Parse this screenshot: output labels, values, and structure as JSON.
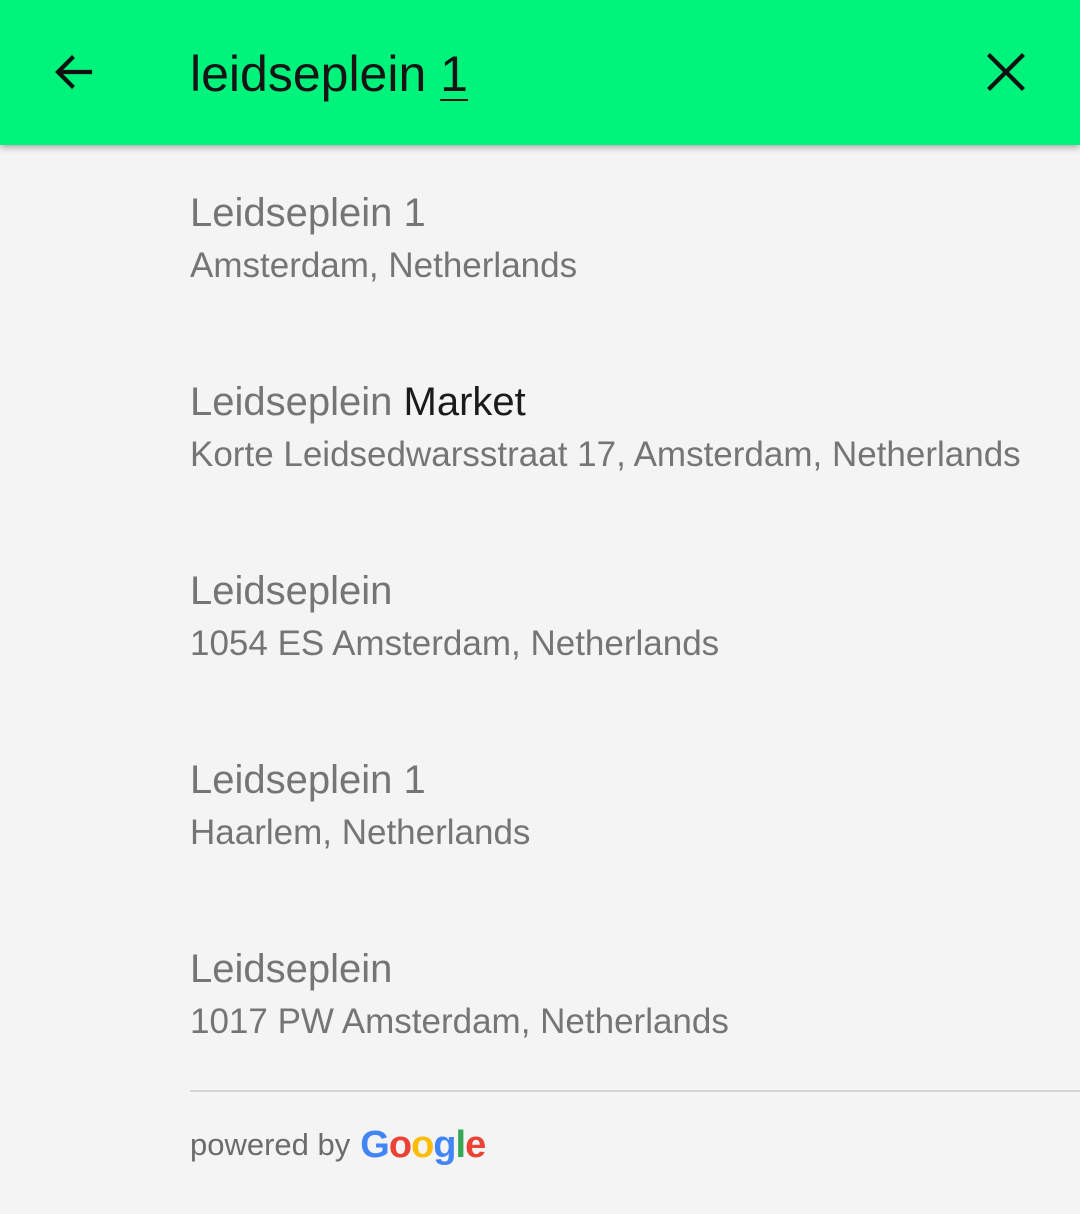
{
  "search": {
    "query_prefix": "leidseplein ",
    "query_underlined": "1"
  },
  "icons": {
    "back": "arrow-back-icon",
    "clear": "close-icon"
  },
  "results": [
    {
      "primary_match": "Leidseplein 1",
      "primary_rest": "",
      "secondary": "Amsterdam, Netherlands"
    },
    {
      "primary_match": "Leidseplein",
      "primary_rest": " Market",
      "secondary": "Korte Leidsedwarsstraat 17, Amsterdam, Netherlands"
    },
    {
      "primary_match": "Leidseplein",
      "primary_rest": "",
      "secondary": "1054 ES Amsterdam, Netherlands"
    },
    {
      "primary_match": "Leidseplein 1",
      "primary_rest": "",
      "secondary": "Haarlem, Netherlands"
    },
    {
      "primary_match": "Leidseplein",
      "primary_rest": "",
      "secondary": "1017 PW Amsterdam, Netherlands"
    }
  ],
  "footer": {
    "powered_by": "powered by",
    "logo_letters": [
      "G",
      "o",
      "o",
      "g",
      "l",
      "e"
    ],
    "logo_colors": [
      "#4285F4",
      "#EA4335",
      "#FBBC05",
      "#4285F4",
      "#34A853",
      "#EA4335"
    ]
  },
  "colors": {
    "toolbar": "#00f47c",
    "background": "#f4f4f4",
    "text_secondary": "#757575",
    "text_primary": "#1b1b1b"
  }
}
